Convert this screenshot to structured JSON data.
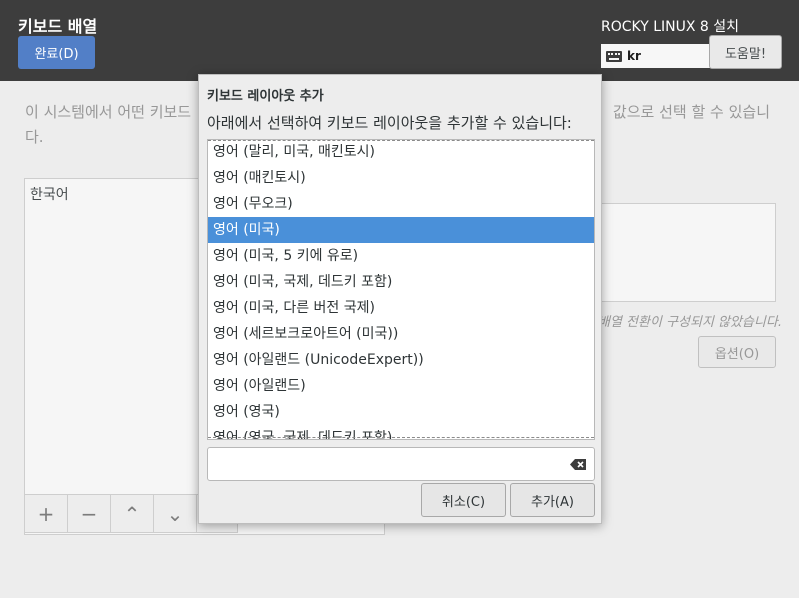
{
  "header": {
    "title": "키보드 배열",
    "done_label": "완료(D)",
    "installer_title": "ROCKY LINUX 8 설치",
    "keyboard_indicator": "kr",
    "help_label": "도움말!"
  },
  "background": {
    "description_start": "이 시스템에서 어떤 키보드",
    "description_end": "값으로 선택 할 수 있습니",
    "description_line2": "다.",
    "layout_list": [
      "한국어"
    ],
    "toolbar": [
      "+",
      "−",
      "⌃",
      "⌄"
    ],
    "switch_note": "배열 전환이 구성되지 않았습니다.",
    "options_label": "옵션(O)"
  },
  "dialog": {
    "title": "키보드 레이아웃 추가",
    "description": "아래에서 선택하여 키보드 레이아웃을 추가할 수 있습니다:",
    "items": [
      "영어 (말리, 미국, 매킨토시)",
      "영어 (매킨토시)",
      "영어 (무오크)",
      "영어 (미국)",
      "영어 (미국, 5 키에 유로)",
      "영어 (미국, 국제, 데드키 포함)",
      "영어 (미국, 다른 버전 국제)",
      "영어 (세르보크로아트어 (미국))",
      "영어 (아일랜드 (UnicodeExpert))",
      "영어 (아일랜드)",
      "영어 (영국)",
      "영어 (영국, 국제, 데드키 포함)"
    ],
    "selected_index": 3,
    "search_value": "",
    "cancel_label": "취소(C)",
    "add_label": "추가(A)"
  }
}
